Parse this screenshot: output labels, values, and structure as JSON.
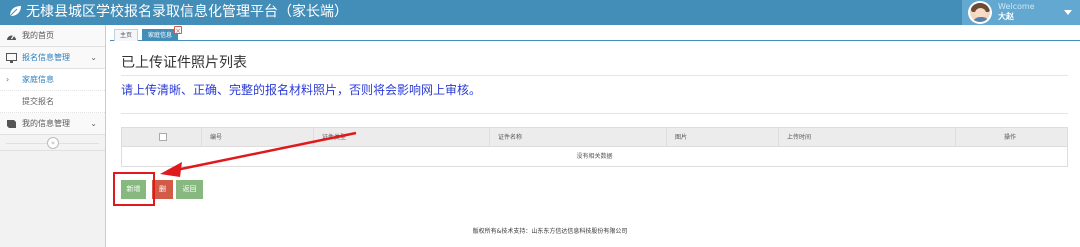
{
  "header": {
    "title": "无棣县城区学校报名录取信息化管理平台（家长端）",
    "welcome": "Welcome",
    "username": "大赵"
  },
  "sidebar": {
    "items": [
      {
        "label": "我的首页",
        "icon": "tachometer-icon"
      },
      {
        "label": "报名信息管理",
        "icon": "desktop-icon",
        "expanded": true,
        "children": [
          {
            "label": "家庭信息",
            "active": true
          },
          {
            "label": "提交报名"
          }
        ]
      },
      {
        "label": "我的信息管理",
        "icon": "book-icon"
      }
    ]
  },
  "tabs": [
    {
      "label": "主页"
    },
    {
      "label": "家庭信息",
      "active": true
    }
  ],
  "main": {
    "title": "已上传证件照片列表",
    "notice": "请上传清晰、正确、完整的报名材料照片，否则将会影响网上审核。",
    "table": {
      "columns": [
        "编号",
        "证件类型",
        "证件名称",
        "图片",
        "上传时间",
        "操作"
      ],
      "empty_text": "没有相关数据"
    },
    "buttons": {
      "add": "新增",
      "delete": "删",
      "back": "返回"
    }
  },
  "footer": {
    "text": "版权所有&技术支持：山东东方信达信息科技股份有限公司"
  },
  "colors": {
    "topbar": "#438eb9",
    "notice": "#2b3bd6",
    "add_button": "#87b87f",
    "delete_button": "#d15b47",
    "annotation": "#e0191d"
  }
}
